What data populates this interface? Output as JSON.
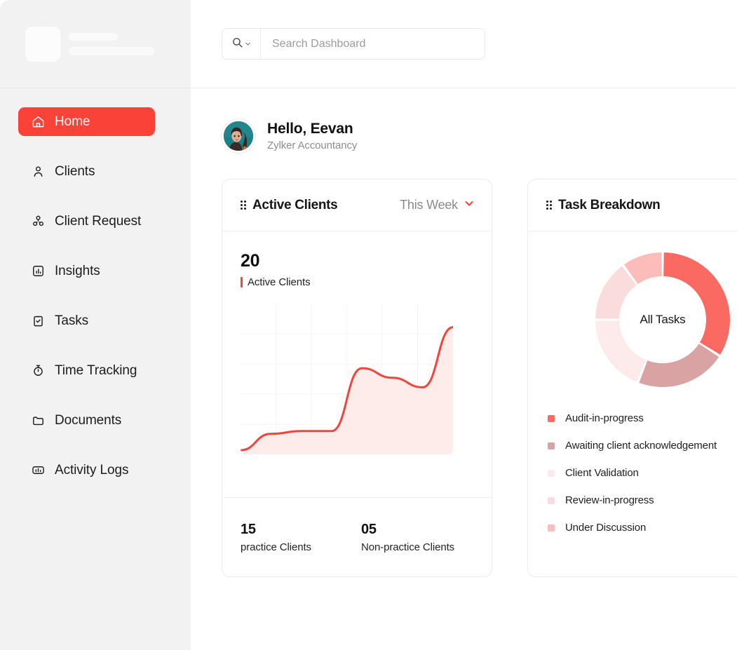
{
  "sidebar": {
    "brand": {
      "logo_placeholder": "",
      "line1_placeholder": "",
      "line2_placeholder": ""
    },
    "items": [
      {
        "label": "Home",
        "icon": "home-icon",
        "active": true
      },
      {
        "label": "Clients",
        "icon": "user-icon",
        "active": false
      },
      {
        "label": "Client Request",
        "icon": "client-request-icon",
        "active": false
      },
      {
        "label": "Insights",
        "icon": "insights-chart-icon",
        "active": false
      },
      {
        "label": "Tasks",
        "icon": "tasks-checklist-icon",
        "active": false
      },
      {
        "label": "Time Tracking",
        "icon": "stopwatch-icon",
        "active": false
      },
      {
        "label": "Documents",
        "icon": "folder-icon",
        "active": false
      },
      {
        "label": "Activity Logs",
        "icon": "activity-logs-icon",
        "active": false
      }
    ]
  },
  "topbar": {
    "search": {
      "placeholder": "Search Dashboard",
      "value": "",
      "scope_icon": "search-icon",
      "scope_chevron": "chevron-down-icon"
    }
  },
  "greeting": {
    "title": "Hello, Eevan",
    "subtitle": "Zylker Accountancy",
    "avatar": "user-photo-avatar"
  },
  "cards": {
    "active_clients": {
      "title": "Active Clients",
      "drag_handle": "drag-handle-icon",
      "period": {
        "label": "This Week",
        "chevron": "chevron-down-icon"
      },
      "headline_value": "20",
      "headline_caption": "Active Clients",
      "stats": [
        {
          "value": "15",
          "label": "practice Clients"
        },
        {
          "value": "05",
          "label": "Non-practice Clients"
        }
      ]
    },
    "task_breakdown": {
      "title": "Task Breakdown",
      "drag_handle": "drag-handle-icon",
      "center_label": "All Tasks",
      "legend": [
        {
          "label": "Audit-in-progress",
          "color": "#fa6a62"
        },
        {
          "label": "Awaiting client acknowledgement",
          "color": "#d9a3a3"
        },
        {
          "label": "Client Validation",
          "color": "#fdeaea"
        },
        {
          "label": "Review-in-progress",
          "color": "#fbdcdc"
        },
        {
          "label": "Under Discussion",
          "color": "#fcbcba"
        }
      ]
    }
  },
  "chart_data": [
    {
      "type": "area",
      "title": "Active Clients",
      "xlabel": "",
      "ylabel": "",
      "grid": true,
      "legend_position": "none",
      "x": [
        0,
        1,
        2,
        3,
        4,
        5,
        6,
        7
      ],
      "values": [
        2,
        14,
        16,
        16,
        62,
        55,
        48,
        92
      ],
      "ylim": [
        0,
        100
      ],
      "line_color": "#f3443c",
      "fill_color": "#fdecea",
      "series": [
        {
          "name": "Active Clients",
          "values": [
            2,
            14,
            16,
            16,
            62,
            55,
            48,
            92
          ]
        }
      ]
    },
    {
      "type": "pie",
      "title": "Task Breakdown",
      "center_label": "All Tasks",
      "legend_position": "bottom-left",
      "categories": [
        "Audit-in-progress",
        "Awaiting client acknowledgement",
        "Client Validation",
        "Review-in-progress",
        "Under Discussion"
      ],
      "values": [
        34,
        22,
        19,
        15,
        10
      ],
      "colors": [
        "#fa6a62",
        "#d9a3a3",
        "#fdeaea",
        "#fbdcdc",
        "#fcbcba"
      ]
    }
  ],
  "theme": {
    "accent": "#fa4238",
    "sidebar_bg": "#f2f2f3",
    "card_border": "#ededee",
    "muted_text": "#8d8d90"
  }
}
